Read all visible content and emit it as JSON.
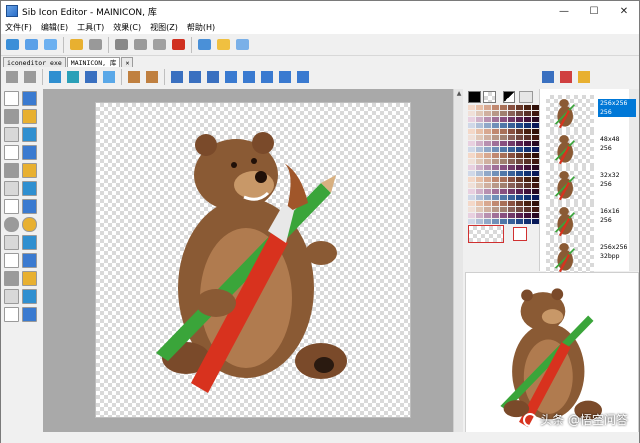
{
  "window": {
    "title": "Sib Icon Editor - MAINICON, 库",
    "controls": {
      "minimize": "—",
      "maximize": "☐",
      "close": "✕"
    }
  },
  "menu": [
    "文件(F)",
    "编辑(E)",
    "工具(T)",
    "效果(C)",
    "视图(Z)",
    "帮助(H)"
  ],
  "tabs": [
    {
      "label": "iconeditor exe",
      "active": false
    },
    {
      "label": "MAINICON, 库",
      "active": true
    }
  ],
  "tab_close": "✕",
  "toolbar": [
    {
      "icon": "new-icon",
      "color": "#3b8fd8"
    },
    {
      "icon": "open-icon",
      "color": "#5aa0e8"
    },
    {
      "icon": "open-library-icon",
      "color": "#6cb0f0"
    },
    {
      "icon": "save-icon",
      "color": "#e8b030"
    },
    {
      "icon": "save-as-icon",
      "color": "#999999"
    },
    {
      "icon": "cut-icon",
      "color": "#888888"
    },
    {
      "icon": "copy-icon",
      "color": "#9a9a9a"
    },
    {
      "icon": "paste-icon",
      "color": "#a0a0a0"
    },
    {
      "icon": "delete-icon",
      "color": "#d03020"
    },
    {
      "icon": "import-icon",
      "color": "#4a90d8"
    },
    {
      "icon": "export-icon",
      "color": "#f0c040"
    },
    {
      "icon": "properties-icon",
      "color": "#7ab0e8"
    }
  ],
  "edit_toolbar": [
    {
      "icon": "undo-icon",
      "color": "#9a9a9a"
    },
    {
      "icon": "redo-icon",
      "color": "#9a9a9a"
    },
    {
      "icon": "layer-front-icon",
      "color": "#2f8fd0"
    },
    {
      "icon": "layer-back-icon",
      "color": "#2aa0b8"
    },
    {
      "icon": "fill-icon",
      "color": "#3a70c0"
    },
    {
      "icon": "drop-icon",
      "color": "#5aa8e8"
    },
    {
      "icon": "grid-icon",
      "color": "#c08040"
    },
    {
      "icon": "crosshair-icon",
      "color": "#c08040"
    },
    {
      "icon": "zoom-in-icon",
      "color": "#3a70c0"
    },
    {
      "icon": "zoom-out-icon",
      "color": "#3a70c0"
    },
    {
      "icon": "zoom-fit-icon",
      "color": "#3a70c0"
    },
    {
      "icon": "move-icon",
      "color": "#3a7ad0"
    },
    {
      "icon": "flip-horizontal-icon",
      "color": "#3a7ad0"
    },
    {
      "icon": "flip-vertical-icon",
      "color": "#3a7ad0"
    },
    {
      "icon": "rotate-left-icon",
      "color": "#3a7ad0"
    },
    {
      "icon": "rotate-right-icon",
      "color": "#3a7ad0"
    }
  ],
  "right_toolbar": [
    {
      "icon": "new-image-icon",
      "color": "#3a70c0"
    },
    {
      "icon": "delete-image-icon",
      "color": "#d04040"
    },
    {
      "icon": "image-properties-icon",
      "color": "#e8b030"
    }
  ],
  "tools": [
    "select-rect-icon",
    "pencil-icon",
    "lasso-icon",
    "magic-wand-icon",
    "eraser-icon",
    "fill-bucket-icon",
    "color-picker-icon",
    "brush-icon",
    "spray-icon",
    "text-icon",
    "line-icon",
    "curve-icon",
    "rectangle-icon",
    "filled-rectangle-icon",
    "ellipse-icon",
    "filled-ellipse-icon",
    "rounded-rect-icon",
    "filled-rounded-rect-icon",
    "line-width-icon",
    "dots-icon",
    "brush-size-icon",
    "pattern-icon",
    "shadow-icon",
    "texture-icon",
    "alpha-icon",
    "gradient-icon"
  ],
  "palette": {
    "primary": "#000000",
    "secondary": "#ffffff"
  },
  "image_formats": [
    {
      "label": "256x256\n256",
      "selected": true
    },
    {
      "label": "48x48\n256",
      "selected": false
    },
    {
      "label": "32x32\n256",
      "selected": false
    },
    {
      "label": "16x16\n256",
      "selected": false
    },
    {
      "label": "256x256\n32bpp",
      "selected": false
    }
  ],
  "watermark": "头条 @悟空问答"
}
